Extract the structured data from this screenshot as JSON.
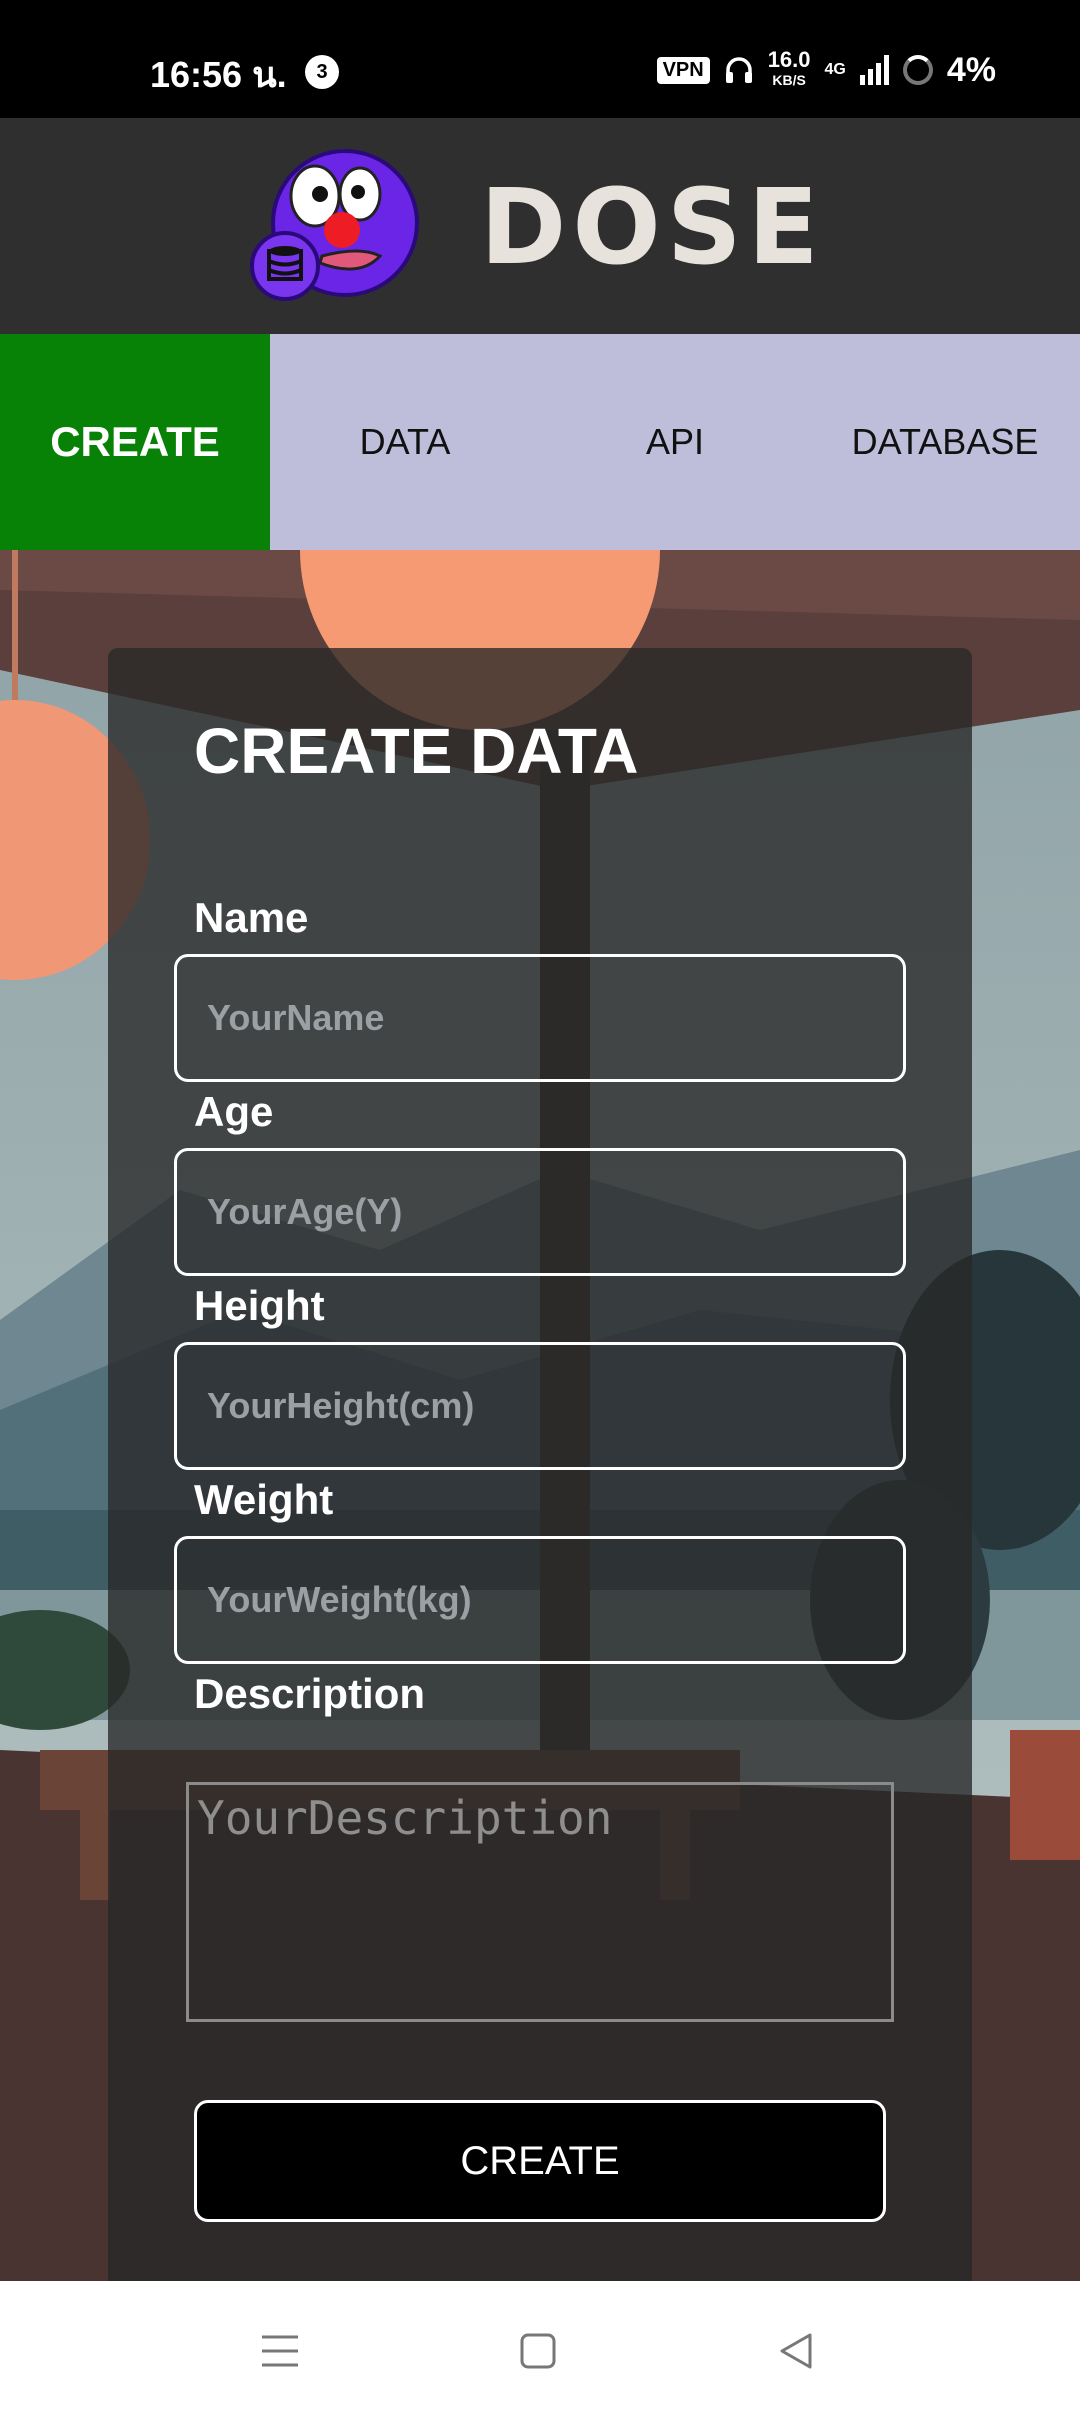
{
  "status_bar": {
    "time": "16:56 น.",
    "notification_count": "3",
    "vpn": "VPN",
    "speed_value": "16.0",
    "speed_unit": "KB/S",
    "network": "4G",
    "battery": "4%"
  },
  "header": {
    "brand": "DOSE"
  },
  "nav": {
    "tabs": [
      {
        "label": "CREATE",
        "active": true
      },
      {
        "label": "DATA"
      },
      {
        "label": "API"
      },
      {
        "label": "DATABASE"
      }
    ]
  },
  "form": {
    "title": "CREATE DATA",
    "name_label": "Name",
    "name_placeholder": "YourName",
    "age_label": "Age",
    "age_placeholder": "YourAge(Y)",
    "height_label": "Height",
    "height_placeholder": "YourHeight(cm)",
    "weight_label": "Weight",
    "weight_placeholder": "YourWeight(kg)",
    "description_label": "Description",
    "description_placeholder": "YourDescription",
    "submit_label": "CREATE"
  },
  "colors": {
    "active_tab": "#078207",
    "nav_bg": "#bebeda",
    "header_bg": "#2f2f2f"
  }
}
